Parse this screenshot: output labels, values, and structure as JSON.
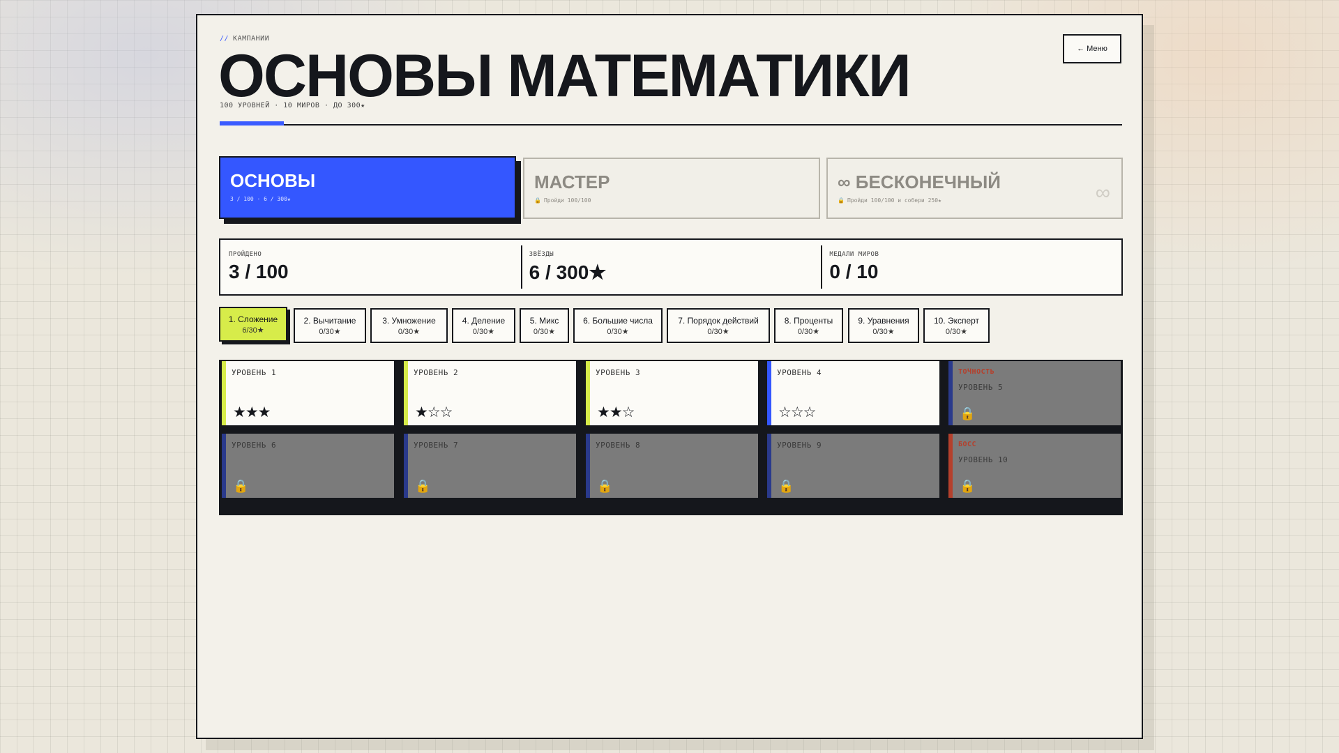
{
  "header": {
    "breadcrumb": "КАМПАНИИ",
    "breadcrumb_prefix": "//",
    "title": "ОСНОВЫ МАТЕМАТИКИ",
    "subtitle": "100 УРОВНЕЙ · 10 МИРОВ · ДО 300★",
    "menu_label": "← Меню"
  },
  "colors": {
    "accent_blue": "#3457ff",
    "accent_lime": "#d7ec4a",
    "locked_gray": "#7b7b7b",
    "ink": "#15171c",
    "danger": "#b5402c"
  },
  "modes": [
    {
      "title": "ОСНОВЫ",
      "sub": "3 / 100 · 6 / 300★",
      "selected": true,
      "locked": false
    },
    {
      "title": "МАСТЕР",
      "sub": "Пройди 100/100",
      "selected": false,
      "locked": true,
      "icon": "lock-icon"
    },
    {
      "title": "∞ БЕСКОНЕЧНЫЙ",
      "sub": "Пройди 100/100 и собери 250★",
      "selected": false,
      "locked": true,
      "icon": "lock-icon",
      "badge": "∞"
    }
  ],
  "stats": [
    {
      "label": "ПРОЙДЕНО",
      "value": "3 / 100"
    },
    {
      "label": "ЗВЁЗДЫ",
      "value": "6 / 300★"
    },
    {
      "label": "МЕДАЛИ МИРОВ",
      "value": "0 / 10"
    }
  ],
  "worlds": [
    {
      "name": "1. Сложение",
      "stars": "6/30★",
      "active": true
    },
    {
      "name": "2. Вычитание",
      "stars": "0/30★",
      "active": false
    },
    {
      "name": "3. Умножение",
      "stars": "0/30★",
      "active": false
    },
    {
      "name": "4. Деление",
      "stars": "0/30★",
      "active": false
    },
    {
      "name": "5. Микс",
      "stars": "0/30★",
      "active": false
    },
    {
      "name": "6. Большие числа",
      "stars": "0/30★",
      "active": false
    },
    {
      "name": "7. Порядок действий",
      "stars": "0/30★",
      "active": false
    },
    {
      "name": "8. Проценты",
      "stars": "0/30★",
      "active": false
    },
    {
      "name": "9. Уравнения",
      "stars": "0/30★",
      "active": false
    },
    {
      "name": "10. Эксперт",
      "stars": "0/30★",
      "active": false
    }
  ],
  "levels": [
    {
      "name": "УРОВЕНЬ 1",
      "stars": "★★★",
      "star_count": 3,
      "locked": false,
      "color": "#d7ec4a"
    },
    {
      "name": "УРОВЕНЬ 2",
      "stars": "★☆☆",
      "star_count": 1,
      "locked": false,
      "color": "#d7ec4a"
    },
    {
      "name": "УРОВЕНЬ 3",
      "stars": "★★☆",
      "star_count": 2,
      "locked": false,
      "color": "#d7ec4a"
    },
    {
      "name": "УРОВЕНЬ 4",
      "stars": "☆☆☆",
      "star_count": 0,
      "locked": false,
      "color": "#3457ff"
    },
    {
      "name": "УРОВЕНЬ 5",
      "tag": "ТОЧНОСТЬ",
      "locked": true,
      "color": "#2a3a8c",
      "tag_color": "#b5402c"
    },
    {
      "name": "УРОВЕНЬ 6",
      "locked": true,
      "color": "#2a3a8c"
    },
    {
      "name": "УРОВЕНЬ 7",
      "locked": true,
      "color": "#2a3a8c"
    },
    {
      "name": "УРОВЕНЬ 8",
      "locked": true,
      "color": "#2a3a8c"
    },
    {
      "name": "УРОВЕНЬ 9",
      "locked": true,
      "color": "#2a3a8c"
    },
    {
      "name": "УРОВЕНЬ 10",
      "tag": "БОСС",
      "locked": true,
      "color": "#b5402c",
      "tag_color": "#b5402c"
    }
  ]
}
